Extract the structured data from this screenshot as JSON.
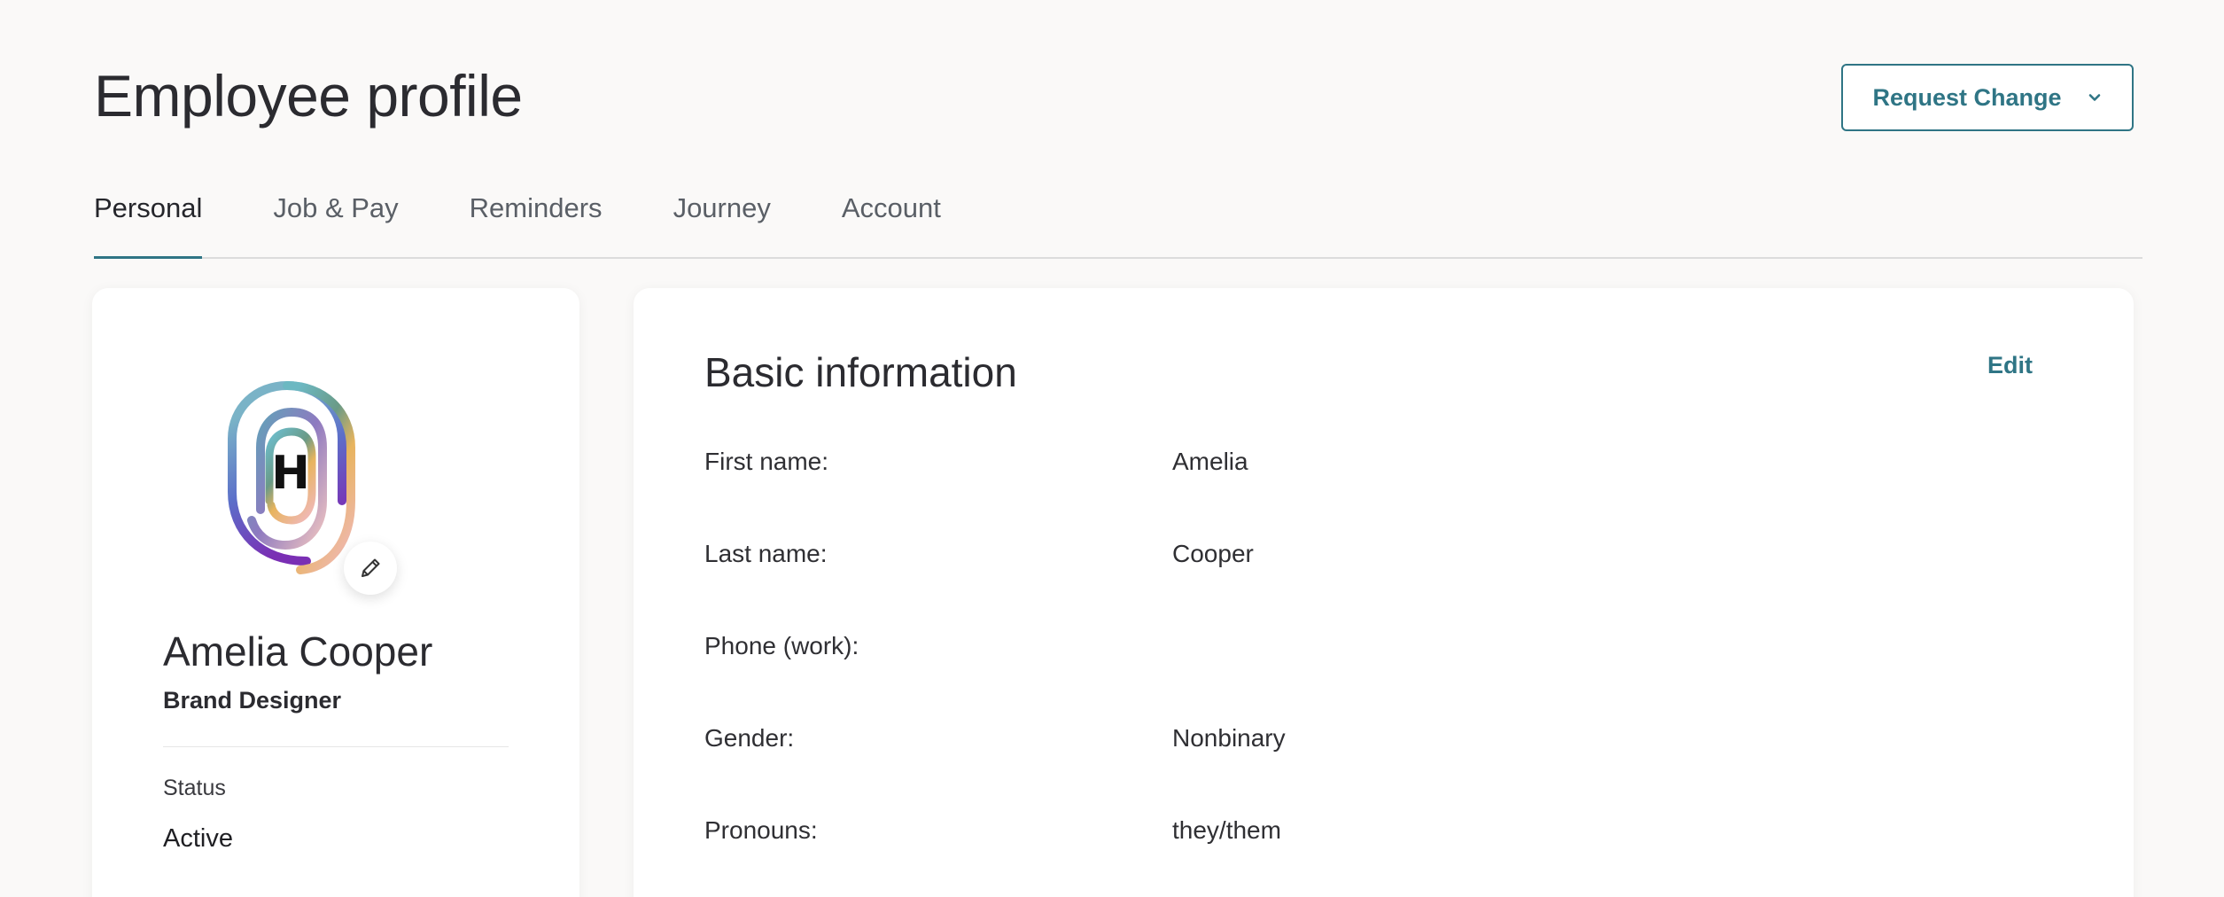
{
  "page": {
    "title": "Employee profile"
  },
  "header": {
    "request_change_label": "Request Change"
  },
  "tabs": [
    {
      "label": "Personal",
      "active": true
    },
    {
      "label": "Job & Pay",
      "active": false
    },
    {
      "label": "Reminders",
      "active": false
    },
    {
      "label": "Journey",
      "active": false
    },
    {
      "label": "Account",
      "active": false
    }
  ],
  "profile": {
    "logo_letter": "H",
    "name": "Amelia Cooper",
    "role": "Brand Designer",
    "status_label": "Status",
    "status_value": "Active"
  },
  "basic_info": {
    "title": "Basic information",
    "edit_label": "Edit",
    "rows": [
      {
        "label": "First name:",
        "value": "Amelia"
      },
      {
        "label": "Last name:",
        "value": "Cooper"
      },
      {
        "label": "Phone (work):",
        "value": ""
      },
      {
        "label": "Gender:",
        "value": "Nonbinary"
      },
      {
        "label": "Pronouns:",
        "value": "they/them"
      }
    ]
  },
  "colors": {
    "accent": "#2f7585",
    "background": "#faf9f8",
    "card": "#ffffff",
    "text": "#2b2b30"
  },
  "icons": {
    "chevron": "chevron-down-icon",
    "pencil": "pencil-icon",
    "logo": "fingerprint-logo-icon"
  }
}
